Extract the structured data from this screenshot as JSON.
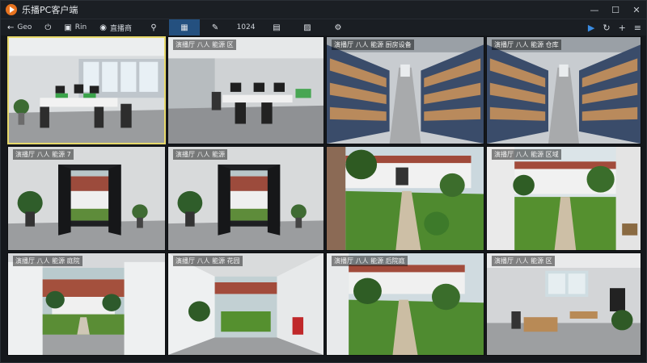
{
  "app": {
    "title": "乐播PC客户端"
  },
  "window_controls": [
    "minimize-icon",
    "maximize-icon",
    "close-icon"
  ],
  "toolbar": {
    "items": [
      {
        "name": "back",
        "icon": "←",
        "label": "Geo"
      },
      {
        "name": "power",
        "icon": "⏻",
        "label": ""
      },
      {
        "name": "camera",
        "icon": "▣",
        "label": "Rin"
      },
      {
        "name": "record",
        "icon": "◉",
        "label": "直播商"
      }
    ],
    "tabs": [
      {
        "name": "user-search",
        "icon": "⚲",
        "label": ""
      },
      {
        "name": "grid",
        "icon": "▦",
        "label": "",
        "active": true
      },
      {
        "name": "edit",
        "icon": "✎",
        "label": ""
      },
      {
        "name": "1024",
        "icon": "",
        "label": "1024"
      },
      {
        "name": "clipboard",
        "icon": "▤",
        "label": ""
      },
      {
        "name": "image",
        "icon": "▨",
        "label": ""
      },
      {
        "name": "settings",
        "icon": "⚙",
        "label": ""
      }
    ],
    "right": [
      {
        "name": "play-icon",
        "icon": "▶"
      },
      {
        "name": "refresh-icon",
        "icon": "↻"
      },
      {
        "name": "add-icon",
        "icon": "+"
      },
      {
        "name": "menu-icon",
        "icon": "≡"
      }
    ]
  },
  "cameras": [
    {
      "scene": "office",
      "caption": "",
      "selected": true
    },
    {
      "scene": "office2",
      "caption": "演播厅 八人  能源 区"
    },
    {
      "scene": "warehouse",
      "caption": "演播厅 八人  能源  厨房设备"
    },
    {
      "scene": "warehouse",
      "caption": "演播厅 八人  能源 仓库"
    },
    {
      "scene": "doorway",
      "caption": "演播厅 八人  能源 7"
    },
    {
      "scene": "doorway",
      "caption": "演播厅 八人  能源"
    },
    {
      "scene": "garden",
      "caption": ""
    },
    {
      "scene": "courtyard",
      "caption": "演播厅 八人  能源  区域"
    },
    {
      "scene": "doorway2",
      "caption": "演播厅 八人  能源 庭院"
    },
    {
      "scene": "corridor",
      "caption": "演播厅 八人  能源 花园"
    },
    {
      "scene": "garden2",
      "caption": "演播厅 八人  能源 后院庭"
    },
    {
      "scene": "room",
      "caption": "演播厅 八人  能源 区"
    }
  ]
}
